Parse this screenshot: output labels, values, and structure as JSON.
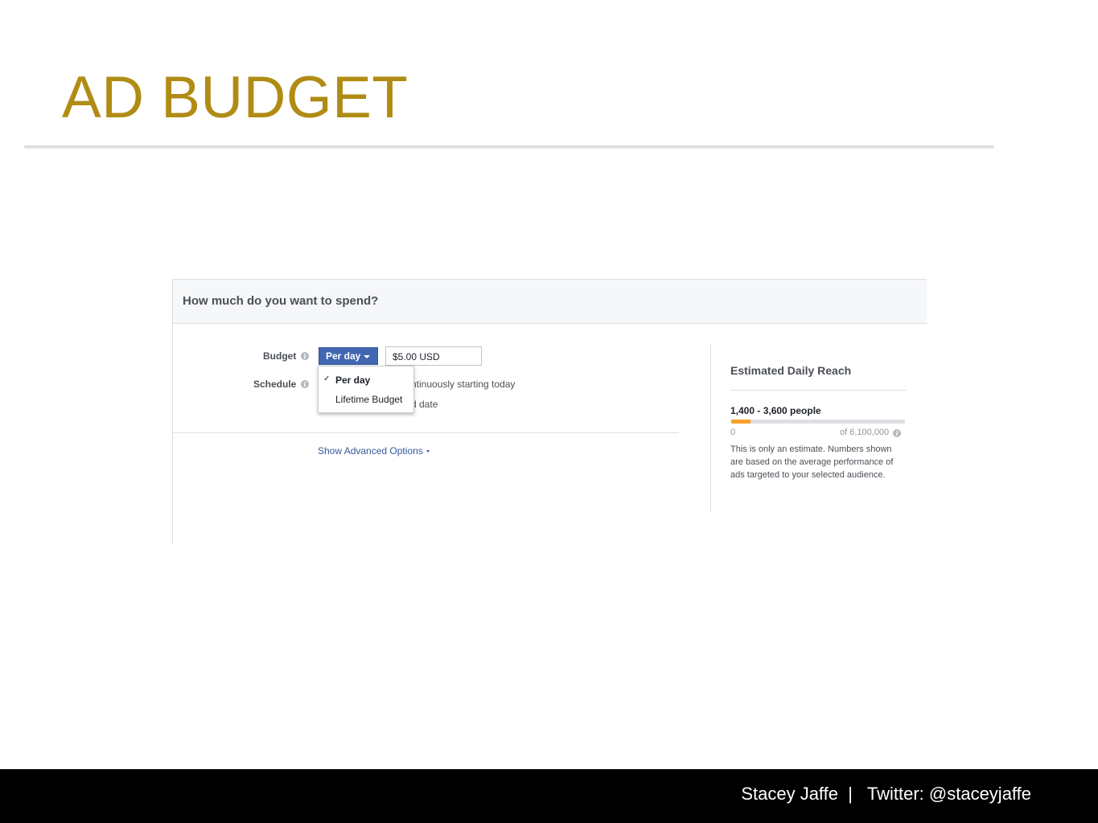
{
  "slide": {
    "title": "AD BUDGET",
    "footer": "Stacey Jaffe  |   Twitter: @staceyjaffe"
  },
  "panel": {
    "header_title": "How much do you want to spend?",
    "budget_label": "Budget",
    "schedule_label": "Schedule",
    "budget_type_selected": "Per day",
    "budget_amount": "$5.00 USD",
    "schedule_option_1": "ntinuously starting today",
    "schedule_option_2": "d date",
    "dropdown_options": [
      "Per day",
      "Lifetime Budget"
    ],
    "dropdown_check": "✓",
    "advanced_options_link": "Show Advanced Options",
    "info_glyph": "i"
  },
  "reach": {
    "title": "Estimated Daily Reach",
    "range": "1,400 - 3,600 people",
    "min_label": "0",
    "max_label": "of 6,100,000",
    "estimate_fraction": 0.11,
    "fill_color": "#f7a12b",
    "note": "This is only an estimate. Numbers shown are based on the average performance of ads targeted to your selected audience."
  },
  "colors": {
    "title_gold": "#B08C14",
    "select_blue": "#4267b2",
    "link_blue": "#365899",
    "footer_bg": "#000000"
  }
}
